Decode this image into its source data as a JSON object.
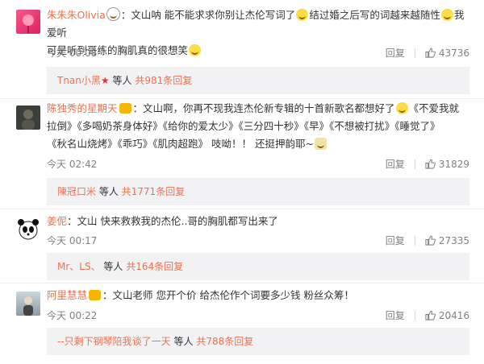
{
  "comments": [
    {
      "user": "朱朱朱Olivia",
      "text_a": "：文山呐 能不能求求你别让杰伦写词了",
      "text_b": "结过婚之后写的词越来越随性",
      "text_c": "我爱听",
      "text_d": "可是听到哥练的胸肌真的很想笑",
      "time": "今天 00:08",
      "reply_label": "回复",
      "likes": "43736",
      "replies": {
        "user": "Tnan小黑",
        "mid": " 等人 ",
        "count": "共981条回复"
      }
    },
    {
      "user": "陈独秀的星期天",
      "text_a": "：文山啊，你再不现我连杰伦新专辑的十首新歌名都想好了",
      "text_b": "《不爱我就",
      "line2": "拉倒》《多喝奶茶身体好》《给你的爱太少》《三分四十秒》《早》《不想被打扰》《睡觉了》",
      "line3": "《秋名山烧烤》《乖巧》《肌肉超跑》 吱呦！！ 还挺押韵耶~",
      "time": "今天 02:42",
      "reply_label": "回复",
      "likes": "31829",
      "replies": {
        "user": "陳冠口米",
        "mid": " 等人 ",
        "count": "共1771条回复"
      }
    },
    {
      "user": "姜伲",
      "text_a": "：文山  快来救救我的杰伦..哥的胸肌都写出来了",
      "time": "今天 00:17",
      "reply_label": "回复",
      "likes": "27335",
      "replies": {
        "user": "Mr、LS、",
        "mid": " 等人 ",
        "count": "共164条回复"
      }
    },
    {
      "user": "阿里慧慧",
      "text_a": "：文山老师 您开个价 给杰伦作个词要多少钱 粉丝众筹！",
      "time": "今天 00:22",
      "reply_label": "回复",
      "likes": "20416",
      "replies": {
        "user": "--只剩下钢琴陪我谈了一天",
        "mid": " 等人 ",
        "count": "共788条回复"
      }
    }
  ],
  "colors": {
    "accent": "#eb7350",
    "reply_bg": "#f2f2f5",
    "meta": "#808080"
  },
  "icons": [
    "panda-emoji-icon",
    "laugh-cry-emoji-icon",
    "star-badge-icon",
    "vip-badge-icon",
    "thumbs-up-icon"
  ]
}
